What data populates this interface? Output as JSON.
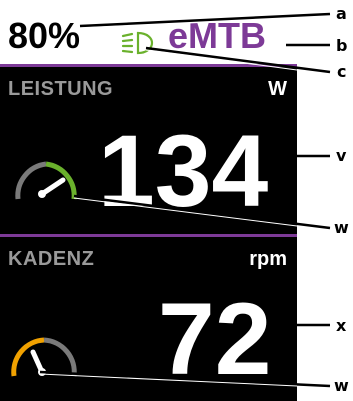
{
  "status": {
    "battery": "80%",
    "mode": "eMTB"
  },
  "power": {
    "label": "LEISTUNG",
    "unit": "W",
    "value": "134",
    "gauge_level": 0.55
  },
  "cadence": {
    "label": "KADENZ",
    "unit": "rpm",
    "value": "72",
    "gauge_level": 0.3
  },
  "callouts": {
    "a": "a",
    "b": "b",
    "c": "c",
    "v": "v",
    "w1": "w",
    "x": "x",
    "w2": "w"
  },
  "colors": {
    "mode": "#7d3a97",
    "light": "#6ab12c",
    "power_gauge": "#6ab12c",
    "cadence_gauge": "#f0a100",
    "gauge_track": "#7a7a7a"
  },
  "icons": {
    "light": "headlight-icon"
  }
}
